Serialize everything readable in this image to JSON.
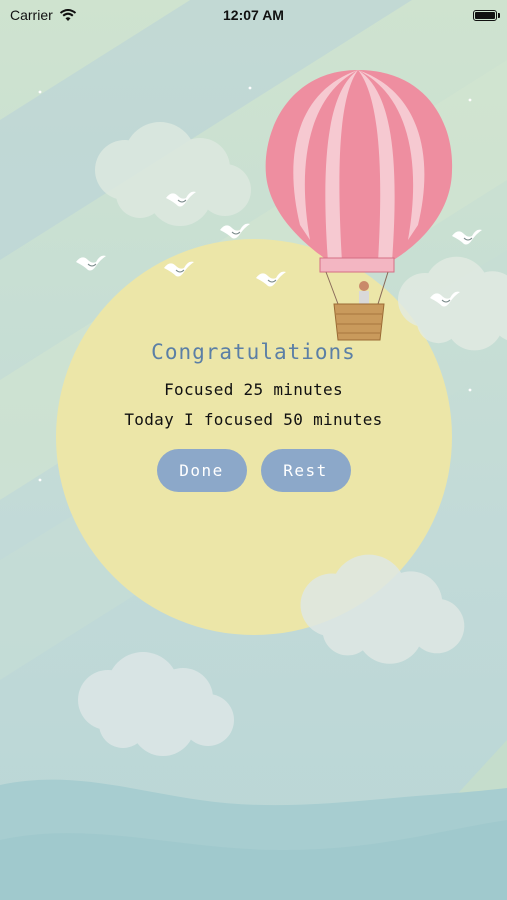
{
  "status_bar": {
    "carrier": "Carrier",
    "time": "12:07 AM",
    "battery_level": 0.95
  },
  "dialog": {
    "title": "Congratulations",
    "focused_line": "Focused 25 minutes",
    "today_line": "Today I focused 50 minutes",
    "done_label": "Done",
    "rest_label": "Rest"
  },
  "colors": {
    "title": "#5b7fa6",
    "button": "#8ca8c9",
    "sun": "#ece6a8",
    "balloon": "#e97b8f"
  },
  "icons": [
    "wifi-icon",
    "battery-icon",
    "balloon-icon",
    "bird-icon",
    "cloud-icon",
    "sun-icon"
  ]
}
